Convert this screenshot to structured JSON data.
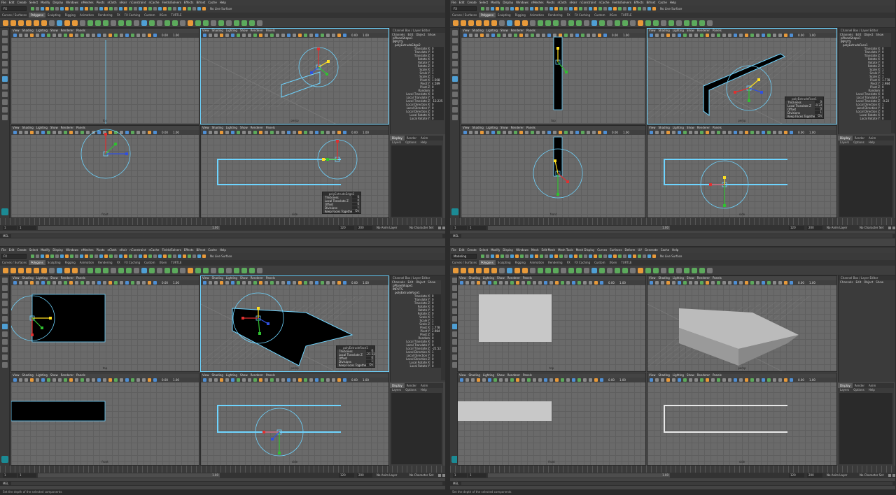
{
  "menus": {
    "q1": [
      "File",
      "Edit",
      "Create",
      "Select",
      "Modify",
      "Display",
      "Windows",
      "nMeshes",
      "Pivots",
      "nCloth",
      "nHair",
      "nConstraint",
      "nCache",
      "Fields/Solvers",
      "Effects",
      "Bifrost",
      "Cache",
      "Help"
    ],
    "q2": [
      "File",
      "Edit",
      "Create",
      "Select",
      "Modify",
      "Display",
      "Windows",
      "nMeshes",
      "Pivots",
      "nCloth",
      "nHair",
      "nConstraint",
      "nCache",
      "Fields/Solvers",
      "Effects",
      "Bifrost",
      "Cache",
      "Help"
    ],
    "q3": [
      "File",
      "Edit",
      "Create",
      "Select",
      "Modify",
      "Display",
      "Windows",
      "nMeshes",
      "Pivots",
      "nCloth",
      "nHair",
      "nConstraint",
      "nCache",
      "Fields/Solvers",
      "Effects",
      "Bifrost",
      "Cache",
      "Help"
    ],
    "q4": [
      "File",
      "Edit",
      "Create",
      "Select",
      "Modify",
      "Display",
      "Windows",
      "Mesh",
      "Edit Mesh",
      "Mesh Tools",
      "Mesh Display",
      "Curves",
      "Surfaces",
      "Deform",
      "UV",
      "Generate",
      "Cache",
      "Help"
    ]
  },
  "mode": {
    "q1": "FX",
    "q2": "FX",
    "q3": "FX",
    "q4": "Modeling"
  },
  "live_surface": "No Live Surface",
  "shelf_tabs": [
    "Curves / Surfaces",
    "Polygons",
    "Sculpting",
    "Rigging",
    "Animation",
    "Rendering",
    "FX",
    "FX Caching",
    "Custom",
    "XGen",
    "TURTLE"
  ],
  "active_shelf_tab": "Polygons",
  "viewport_menu": [
    "View",
    "Shading",
    "Lighting",
    "Show",
    "Renderer",
    "Panels"
  ],
  "viewport_nums": {
    "a": "0.00",
    "b": "1.00"
  },
  "view_labels": {
    "top": "top",
    "persp": "persp",
    "front": "front",
    "side": "side"
  },
  "channel_box": {
    "title": "Channel Box / Layer Editor",
    "menu": [
      "Channels",
      "Edit",
      "Object",
      "Show"
    ],
    "shape": "pPlaneShape1",
    "inputs": "INPUTS",
    "q1": {
      "node": "polyExtrudeEdge2",
      "attrs": [
        {
          "name": "Translate X",
          "value": "0"
        },
        {
          "name": "Translate Y",
          "value": "0"
        },
        {
          "name": "Translate Z",
          "value": "0"
        },
        {
          "name": "Rotate X",
          "value": "0"
        },
        {
          "name": "Rotate Y",
          "value": "0"
        },
        {
          "name": "Rotate Z",
          "value": "0"
        },
        {
          "name": "Scale X",
          "value": "1"
        },
        {
          "name": "Scale Y",
          "value": "1"
        },
        {
          "name": "Scale Z",
          "value": "1"
        },
        {
          "name": "Pivot X",
          "value": "1.508"
        },
        {
          "name": "Pivot Y",
          "value": "4.589"
        },
        {
          "name": "Pivot Z",
          "value": "0"
        },
        {
          "name": "Random",
          "value": "0"
        },
        {
          "name": "Local Translate X",
          "value": "0"
        },
        {
          "name": "Local Translate Y",
          "value": "0"
        },
        {
          "name": "Local Translate Z",
          "value": "-13.225"
        },
        {
          "name": "Local Direction X",
          "value": "0"
        },
        {
          "name": "Local Direction Y",
          "value": "0"
        },
        {
          "name": "Local Direction Z",
          "value": "0"
        },
        {
          "name": "Local Rotate X",
          "value": "0"
        },
        {
          "name": "Local Rotate Y",
          "value": "0"
        }
      ]
    },
    "q2": {
      "node": "polyExtrudeFace1",
      "attrs": [
        {
          "name": "Translate X",
          "value": "0"
        },
        {
          "name": "Translate Y",
          "value": "0"
        },
        {
          "name": "Translate Z",
          "value": "0"
        },
        {
          "name": "Rotate X",
          "value": "0"
        },
        {
          "name": "Rotate Y",
          "value": "0"
        },
        {
          "name": "Rotate Z",
          "value": "0"
        },
        {
          "name": "Scale X",
          "value": "1"
        },
        {
          "name": "Scale Y",
          "value": "1"
        },
        {
          "name": "Scale Z",
          "value": "1"
        },
        {
          "name": "Pivot X",
          "value": "1.778"
        },
        {
          "name": "Pivot Y",
          "value": "2.984"
        },
        {
          "name": "Pivot Z",
          "value": "0"
        },
        {
          "name": "Random",
          "value": "0"
        },
        {
          "name": "Local Translate X",
          "value": "0"
        },
        {
          "name": "Local Translate Y",
          "value": "0"
        },
        {
          "name": "Local Translate Z",
          "value": "-0.22"
        },
        {
          "name": "Local Direction X",
          "value": "1"
        },
        {
          "name": "Local Direction Y",
          "value": "0"
        },
        {
          "name": "Local Direction Z",
          "value": "0"
        },
        {
          "name": "Local Rotate X",
          "value": "0"
        },
        {
          "name": "Local Rotate Y",
          "value": "0"
        }
      ]
    },
    "q3": {
      "node": "polyExtrudeFace1",
      "attrs": [
        {
          "name": "Translate X",
          "value": "0"
        },
        {
          "name": "Translate Y",
          "value": "0"
        },
        {
          "name": "Translate Z",
          "value": "0"
        },
        {
          "name": "Rotate X",
          "value": "0"
        },
        {
          "name": "Rotate Y",
          "value": "0"
        },
        {
          "name": "Rotate Z",
          "value": "0"
        },
        {
          "name": "Scale X",
          "value": "1"
        },
        {
          "name": "Scale Y",
          "value": "1"
        },
        {
          "name": "Scale Z",
          "value": "1"
        },
        {
          "name": "Pivot X",
          "value": "1.778"
        },
        {
          "name": "Pivot Y",
          "value": "2.984"
        },
        {
          "name": "Pivot Z",
          "value": "0"
        },
        {
          "name": "Random",
          "value": "0"
        },
        {
          "name": "Local Translate X",
          "value": "0"
        },
        {
          "name": "Local Translate Y",
          "value": "0"
        },
        {
          "name": "Local Translate Z",
          "value": "-21.52"
        },
        {
          "name": "Local Direction X",
          "value": "1"
        },
        {
          "name": "Local Direction Y",
          "value": "0"
        },
        {
          "name": "Local Direction Z",
          "value": "0"
        },
        {
          "name": "Local Rotate X",
          "value": "0"
        },
        {
          "name": "Local Rotate Y",
          "value": "0"
        }
      ]
    }
  },
  "layer_tabs": [
    "Display",
    "Render",
    "Anim"
  ],
  "layer_menu": [
    "Layers",
    "Options",
    "Help"
  ],
  "dialogs": {
    "q1": {
      "title": "polyExtrudeEdge2",
      "rows": [
        {
          "label": "Thickness",
          "value": "0"
        },
        {
          "label": "Local Translate Z",
          "value": "0"
        },
        {
          "label": "Offset",
          "value": "0"
        },
        {
          "label": "Divisions",
          "value": "1"
        },
        {
          "label": "Keep Faces Together",
          "value": "On"
        }
      ]
    },
    "q2": {
      "title": "polyExtrudeFace1",
      "rows": [
        {
          "label": "Thickness",
          "value": "0"
        },
        {
          "label": "Local Translate Z",
          "value": "-0.22"
        },
        {
          "label": "Offset",
          "value": "0"
        },
        {
          "label": "Divisions",
          "value": "1"
        },
        {
          "label": "Keep Faces Together",
          "value": "On"
        }
      ]
    },
    "q3": {
      "title": "polyExtrudeFace1",
      "rows": [
        {
          "label": "Thickness",
          "value": "0"
        },
        {
          "label": "Local Translate Z",
          "value": "-21.52"
        },
        {
          "label": "Offset",
          "value": "0"
        },
        {
          "label": "Divisions",
          "value": "1"
        },
        {
          "label": "Keep Faces Together",
          "value": "On"
        }
      ]
    }
  },
  "time_range": {
    "start": "1",
    "start2": "1",
    "end": "120",
    "end_inner": "1.00",
    "max": "200"
  },
  "no_anim_layer": "No Anim Layer",
  "no_char_set": "No Character Set",
  "mel": "MEL",
  "help_line": "Set the depth of the selected components",
  "colors": {
    "selection": "#6ed4ff",
    "grid": "#6a6a6a",
    "x_axis": "#e03030",
    "y_axis": "#30c030",
    "z_axis": "#3050e0",
    "yellow_axis": "#ffe020",
    "mesh_gray": "#c8c8c8"
  }
}
